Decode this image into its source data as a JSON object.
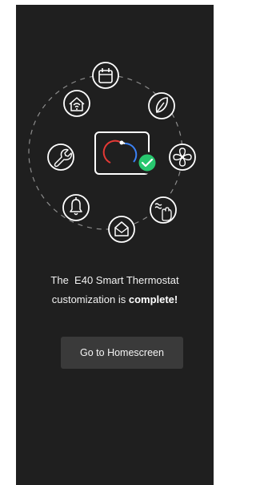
{
  "message": {
    "line1_prefix": "The",
    "device_name": "E40 Smart Thermostat",
    "line2_prefix": "customization is",
    "line2_emphasis": "complete!"
  },
  "cta": {
    "label": "Go to Homescreen"
  },
  "hero": {
    "center": "thermostat-icon",
    "badge": "checkmark-icon",
    "ring_icons": [
      "calendar-icon",
      "leaf-icon",
      "fan-icon",
      "hand-heat-icon",
      "envelope-icon",
      "bell-icon",
      "wrench-icon",
      "smart-home-icon"
    ]
  },
  "colors": {
    "background": "#1f1f1f",
    "accent_green": "#28c76f",
    "dial_red": "#e53935",
    "dial_blue": "#3b82f6",
    "button_bg": "#3a3a3a"
  }
}
